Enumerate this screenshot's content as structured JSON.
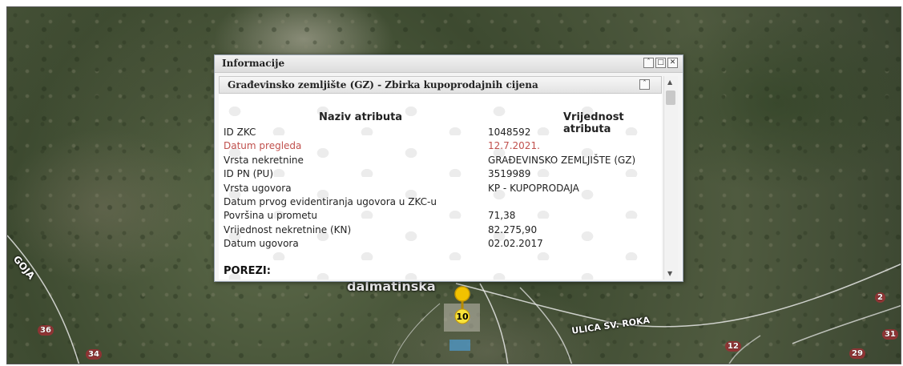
{
  "map": {
    "road_labels": {
      "dalmatinska": "dalmatinska",
      "ulica_sv_roka": "ULICA SV. ROKA",
      "left_road": "GOJA"
    },
    "house_numbers": [
      "36",
      "34",
      "2",
      "31",
      "12",
      "29"
    ],
    "pin_number": "10"
  },
  "window": {
    "title": "Informacije",
    "tools": [
      "collapse-up-icon",
      "maximize-icon",
      "close-icon"
    ],
    "panel": {
      "title": "Građevinsko zemljište (GZ) - Zbirka kupoprodajnih cijena",
      "col_name": "Naziv atributa",
      "col_value": "Vrijednost atributa",
      "rows": [
        {
          "name": "ID ZKC",
          "value": "1048592"
        },
        {
          "name": "Datum pregleda",
          "value": "12.7.2021."
        },
        {
          "name": "Vrsta nekretnine",
          "value": "GRAĐEVINSKO ZEMLJIŠTE (GZ)"
        },
        {
          "name": "ID PN (PU)",
          "value": "3519989"
        },
        {
          "name": "Vrsta ugovora",
          "value": "KP - KUPOPRODAJA"
        },
        {
          "name": "Datum prvog evidentiranja ugovora u ZKC-u",
          "value": ""
        },
        {
          "name": "Površina u prometu",
          "value": "71,38"
        },
        {
          "name": "Vrijednost nekretnine (KN)",
          "value": "82.275,90"
        },
        {
          "name": "Datum ugovora",
          "value": "02.02.2017"
        }
      ],
      "section": "POREZI:"
    }
  },
  "colors": {
    "highlight_row": "#c0504d",
    "pin": "#f2c200"
  }
}
